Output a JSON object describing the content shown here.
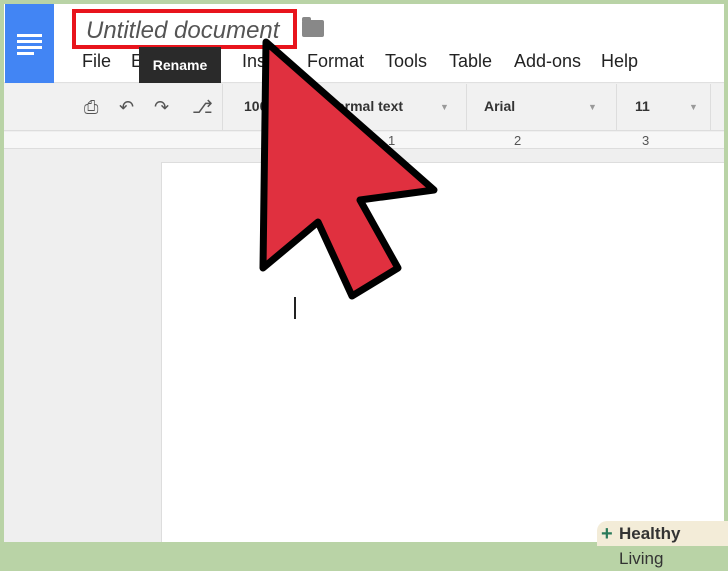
{
  "document": {
    "title": "Untitled document",
    "tooltip": "Rename"
  },
  "menu": [
    "File",
    "E",
    "Insert",
    "Format",
    "Tools",
    "Table",
    "Add-ons",
    "Help"
  ],
  "toolbar": {
    "zoom": "100%",
    "style": "Normal text",
    "font": "Arial",
    "size": "11"
  },
  "ruler": [
    "1",
    "2",
    "3"
  ],
  "watermark": {
    "brand_bold": "Healthy",
    "brand_light": "Living"
  },
  "colors": {
    "highlight": "#e8141c",
    "arrow": "#e0303f",
    "logo": "#4285f4"
  }
}
